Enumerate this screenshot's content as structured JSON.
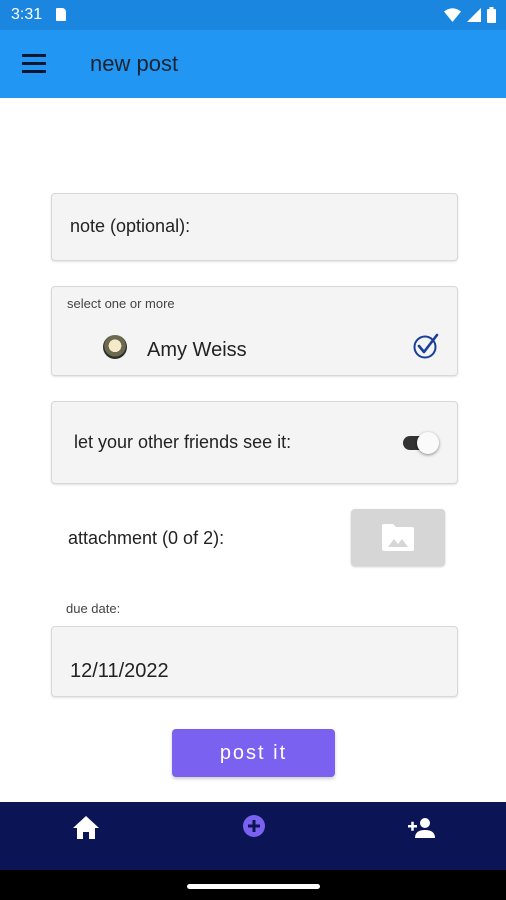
{
  "status_bar": {
    "time": "3:31"
  },
  "app_bar": {
    "title": "new post"
  },
  "form": {
    "note_placeholder": "note (optional):",
    "select_hint": "select one or more",
    "friends": [
      {
        "name": "Amy Weiss",
        "checked": true
      }
    ],
    "share_label": "let your other friends see it:",
    "share_toggle_on": true,
    "attachment_label": "attachment (0 of 2):",
    "due_date_label": "due date:",
    "due_date_value": "12/11/2022",
    "submit_label": "post it"
  },
  "colors": {
    "app_bar": "#2196f3",
    "status_bar": "#1a86e0",
    "accent": "#7b61f0",
    "bottom_nav": "#0b1454",
    "check": "#1a3f9a"
  },
  "bottom_nav": {
    "items": [
      {
        "icon": "home-icon",
        "active": false
      },
      {
        "icon": "add-circle-icon",
        "active": true
      },
      {
        "icon": "person-add-icon",
        "active": false
      }
    ]
  }
}
